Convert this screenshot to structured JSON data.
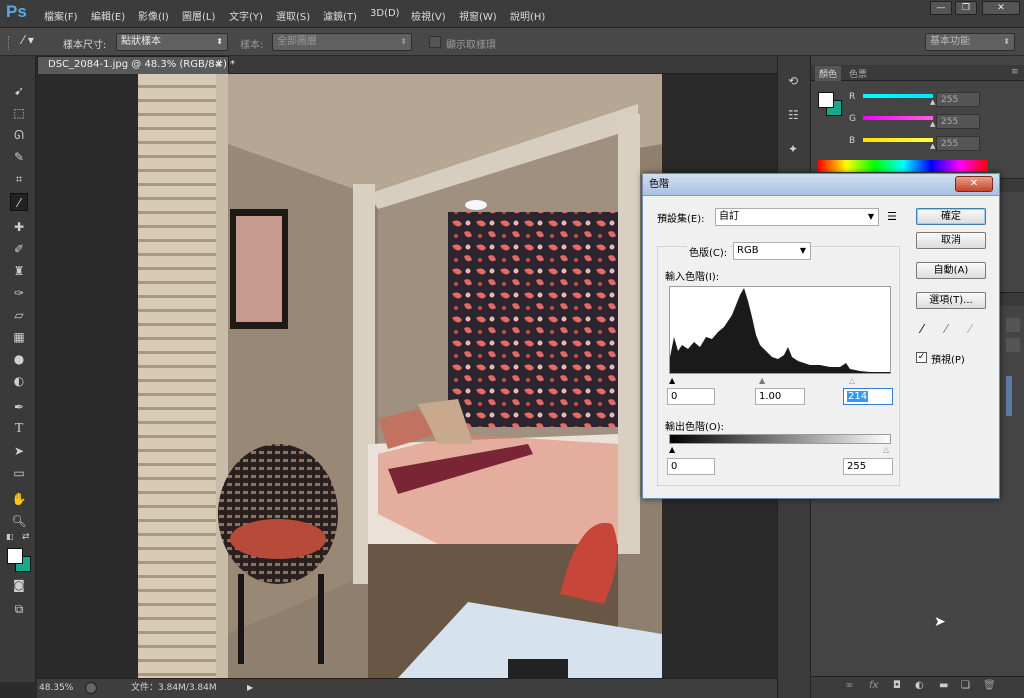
{
  "app": {
    "logo": "Ps"
  },
  "menu": [
    "檔案(F)",
    "編輯(E)",
    "影像(I)",
    "圖層(L)",
    "文字(Y)",
    "選取(S)",
    "濾鏡(T)",
    "3D(D)",
    "檢視(V)",
    "視窗(W)",
    "說明(H)"
  ],
  "window_controls": {
    "minimize": "—",
    "restore": "❐",
    "close": "✕"
  },
  "options": {
    "sample_size_label": "樣本尺寸:",
    "sample_size_value": "點狀樣本",
    "sample_label": "樣本:",
    "sample_value": "全部圖層",
    "show_ring_label": "顯示取樣環",
    "workspace": "基本功能"
  },
  "document": {
    "tab_title": "DSC_2084-1.jpg @ 48.3% (RGB/8#) *",
    "tab_close": "×"
  },
  "status": {
    "zoom": "48.35%",
    "doc_info": "文件：3.84M/3.84M"
  },
  "panel": {
    "tabs": [
      "顏色",
      "色票"
    ],
    "channels": [
      {
        "label": "R",
        "value": "255",
        "color": "#00e5ff"
      },
      {
        "label": "G",
        "value": "255",
        "color": "#ff2bd1"
      },
      {
        "label": "B",
        "value": "255",
        "color": "#ffee00"
      }
    ]
  },
  "colors": {
    "foreground": "#ffffff",
    "background": "#1aa88c"
  },
  "levels_dialog": {
    "title": "色階",
    "preset_label": "預設集(E):",
    "preset_value": "自訂",
    "channel_label": "色版(C):",
    "channel_value": "RGB",
    "input_label": "輸入色階(I):",
    "input_black": "0",
    "input_gamma": "1.00",
    "input_white": "214",
    "output_label": "輸出色階(O):",
    "output_black": "0",
    "output_white": "255",
    "buttons": {
      "ok": "確定",
      "cancel": "取消",
      "auto": "自動(A)",
      "options": "選項(T)..."
    },
    "preview_label": "預視(P)",
    "preview_checked": true
  }
}
